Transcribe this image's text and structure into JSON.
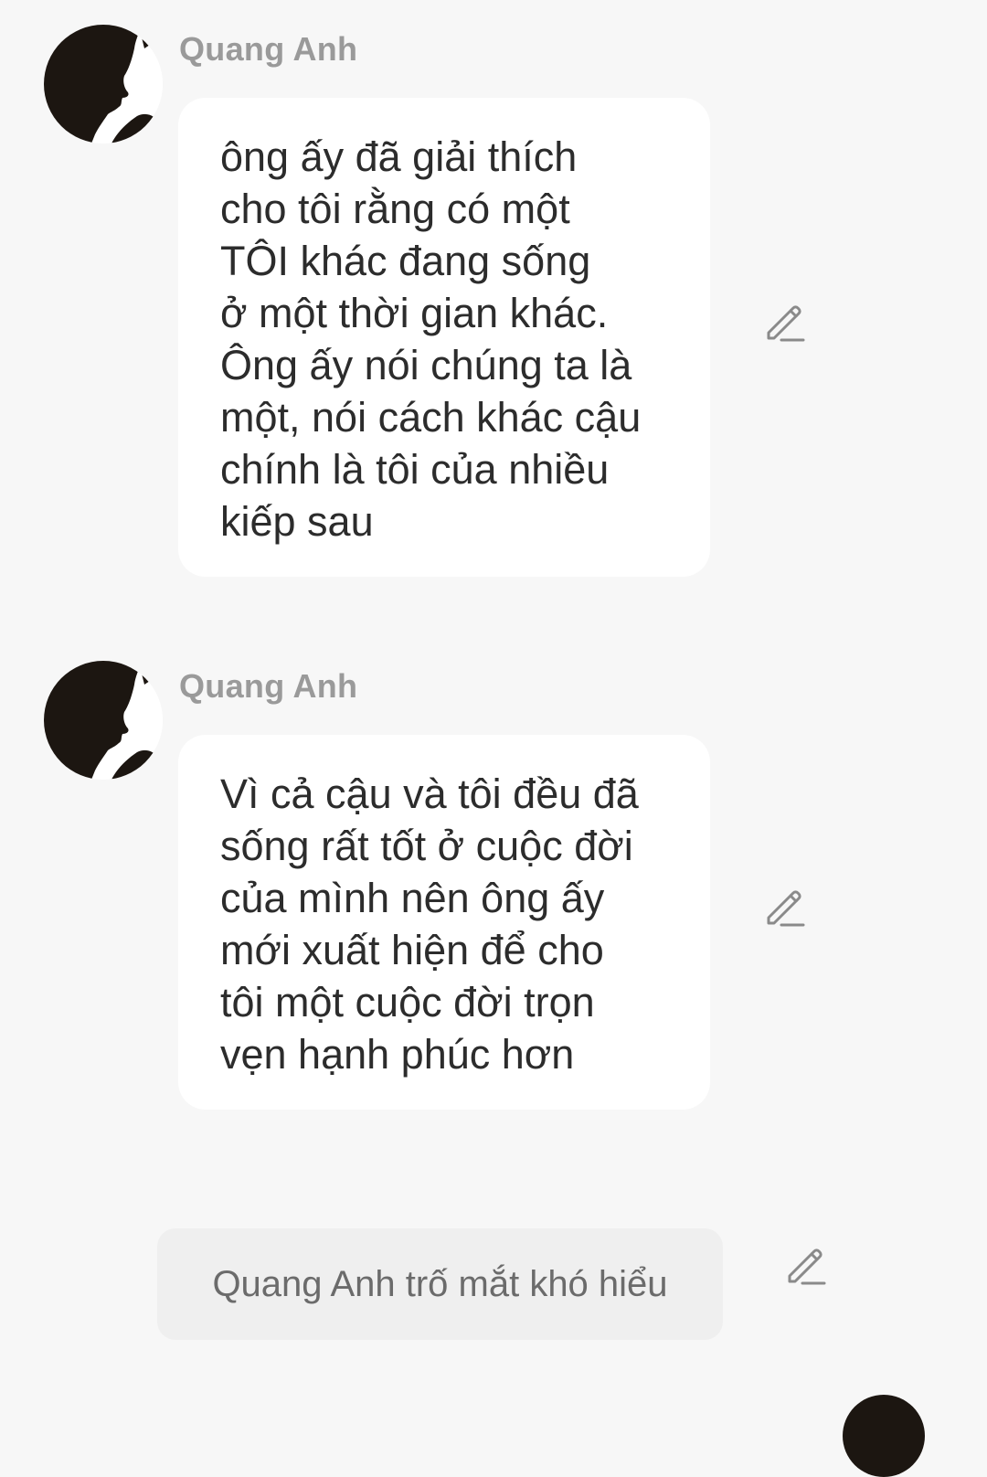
{
  "messages": [
    {
      "sender": "Quang Anh",
      "avatar_icon": "silhouette-avatar-icon",
      "text": "ông ấy đã giải thích\ncho tôi rằng có một\nTÔI khác đang sống\nở một thời gian khác.\nÔng ấy nói chúng ta là\nmột, nói cách khác cậu\nchính là tôi của nhiều\nkiếp sau",
      "action_icon": "edit-pencil-icon"
    },
    {
      "sender": "Quang Anh",
      "avatar_icon": "silhouette-avatar-icon",
      "text": "Vì cả cậu và tôi đều đã\nsống rất tốt ở cuộc đời\ncủa mình nên ông ấy\nmới xuất hiện để cho\ntôi một cuộc đời trọn\nvẹn hạnh phúc hơn",
      "action_icon": "edit-pencil-icon"
    }
  ],
  "narration": {
    "text": "Quang Anh trố mắt khó hiểu",
    "action_icon": "edit-pencil-icon"
  },
  "colors": {
    "background": "#f7f7f7",
    "bubble": "#ffffff",
    "narration_bg": "#efefef",
    "sender_name": "#9a9a9a",
    "message_text": "#2c2c2c",
    "icon": "#8a8a8a"
  }
}
